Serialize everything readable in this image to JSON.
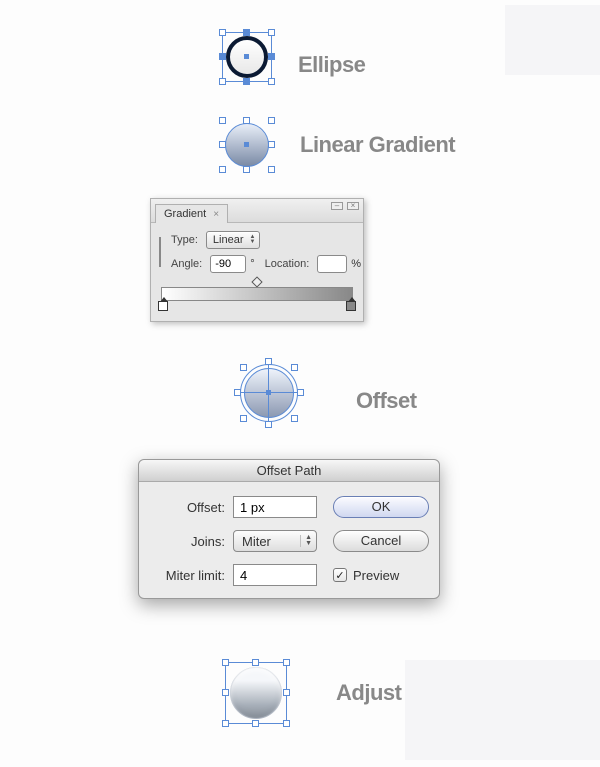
{
  "stages": {
    "ellipse": "Ellipse",
    "linear_gradient": "Linear Gradient",
    "offset": "Offset",
    "adjust": "Adjust"
  },
  "gradient_panel": {
    "tab_label": "Gradient",
    "type_label": "Type:",
    "type_value": "Linear",
    "angle_label": "Angle:",
    "angle_value": "-90",
    "angle_unit": "°",
    "location_label": "Location:",
    "location_value": "",
    "location_unit": "%"
  },
  "offset_dialog": {
    "title": "Offset Path",
    "offset_label": "Offset:",
    "offset_value": "1 px",
    "joins_label": "Joins:",
    "joins_value": "Miter",
    "miter_limit_label": "Miter limit:",
    "miter_limit_value": "4",
    "ok_label": "OK",
    "cancel_label": "Cancel",
    "preview_label": "Preview",
    "preview_checked": true
  }
}
